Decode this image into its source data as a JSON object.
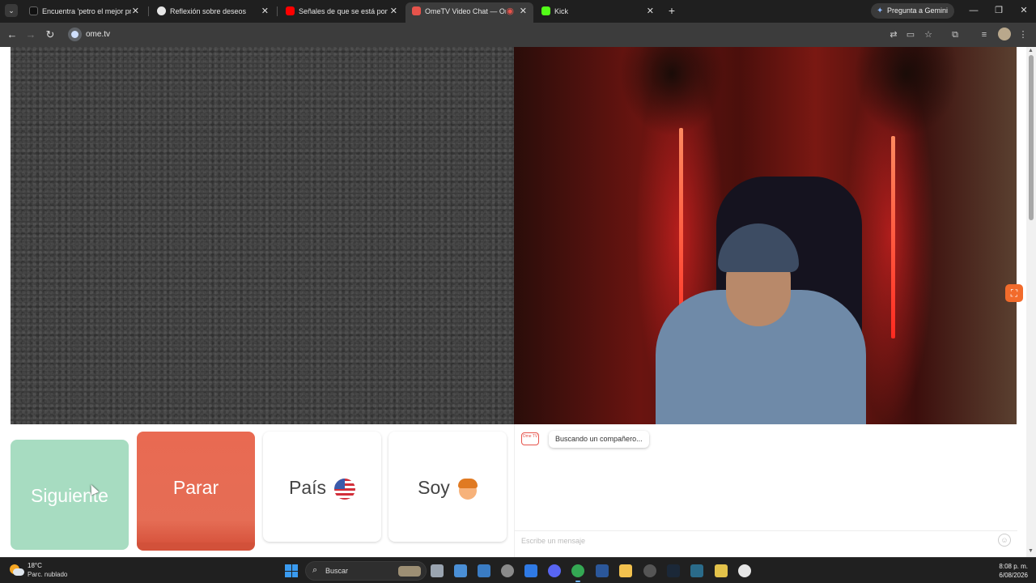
{
  "browser": {
    "tabs": [
      {
        "label": "Encuentra 'petro el mejor presi",
        "favicon_color": "#111111"
      },
      {
        "label": "Reflexión sobre deseos",
        "favicon_color": "#e6e6e6"
      },
      {
        "label": "Señales de que se está poniend",
        "favicon_color": "#ff0000"
      },
      {
        "label": "OmeTV Video Chat — Ome",
        "favicon_color": "#e6534b"
      },
      {
        "label": "Kick",
        "favicon_color": "#53fc18"
      }
    ],
    "new_tab_symbol": "+",
    "gemini_label": "Pregunta a Gemini",
    "url": "ome.tv"
  },
  "controls": {
    "next_label": "Siguiente",
    "stop_label": "Parar",
    "country_label": "País",
    "gender_label": "Soy"
  },
  "chat": {
    "logo_text": "Ome TV",
    "status_message": "Buscando un compañero...",
    "input_placeholder": "Escribe un mensaje"
  },
  "taskbar": {
    "weather_temp": "18°C",
    "weather_desc": "Parc. nublado",
    "search_label": "Buscar",
    "time": "8:08 p. m.",
    "date": "6/08/2026"
  },
  "colors": {
    "next_button": "#a7dcc1",
    "stop_button": "#e56d55",
    "accent_orange": "#f26b2b",
    "ome_red": "#e6534b"
  }
}
